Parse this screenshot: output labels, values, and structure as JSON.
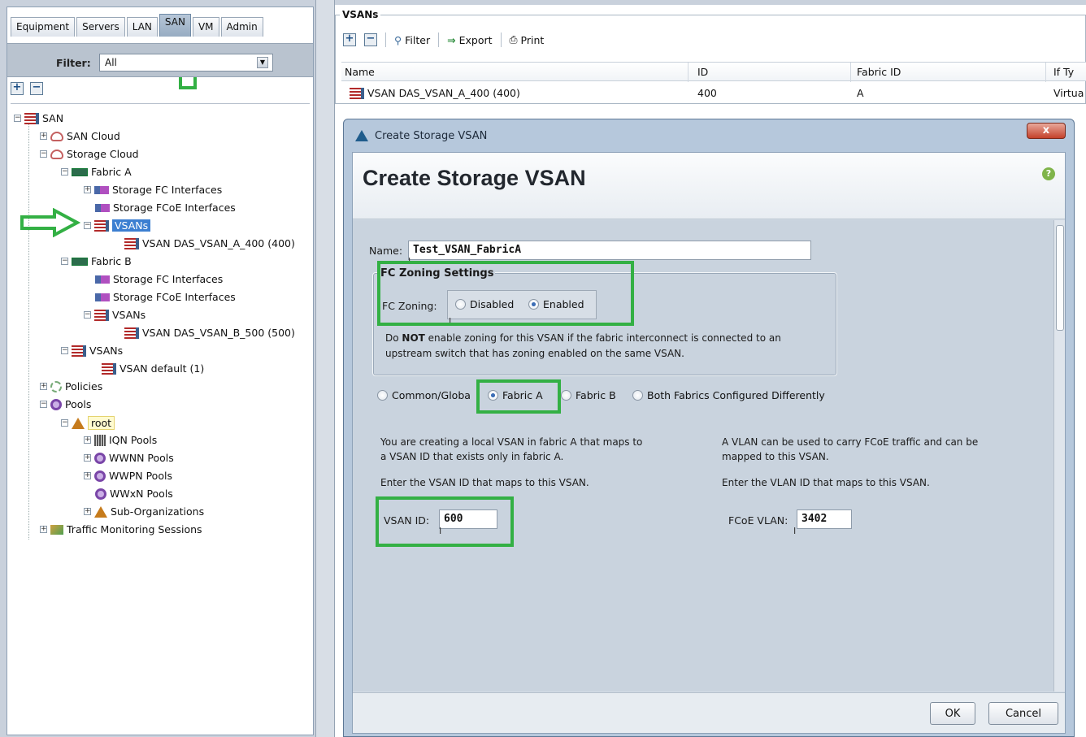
{
  "left": {
    "tabs": [
      "Equipment",
      "Servers",
      "LAN",
      "SAN",
      "VM",
      "Admin"
    ],
    "active_tab": "SAN",
    "filter_label": "Filter:",
    "filter_value": "All",
    "tree": [
      {
        "label": "SAN"
      },
      {
        "label": "SAN Cloud"
      },
      {
        "label": "Storage Cloud"
      },
      {
        "label": "Fabric A"
      },
      {
        "label": "Storage FC Interfaces"
      },
      {
        "label": "Storage FCoE Interfaces"
      },
      {
        "label": "VSANs"
      },
      {
        "label": "VSAN DAS_VSAN_A_400 (400)"
      },
      {
        "label": "Fabric B"
      },
      {
        "label": "Storage FC Interfaces"
      },
      {
        "label": "Storage FCoE Interfaces"
      },
      {
        "label": "VSANs"
      },
      {
        "label": "VSAN DAS_VSAN_B_500 (500)"
      },
      {
        "label": "VSANs"
      },
      {
        "label": "VSAN default (1)"
      },
      {
        "label": "Policies"
      },
      {
        "label": "Pools"
      },
      {
        "label": "root"
      },
      {
        "label": "IQN Pools"
      },
      {
        "label": "WWNN Pools"
      },
      {
        "label": "WWPN Pools"
      },
      {
        "label": "WWxN Pools"
      },
      {
        "label": "Sub-Organizations"
      },
      {
        "label": "Traffic Monitoring Sessions"
      }
    ]
  },
  "right": {
    "section_title": "VSANs",
    "toolbar": {
      "filter": "Filter",
      "export": "Export",
      "print": "Print"
    },
    "columns": [
      "Name",
      "ID",
      "Fabric ID",
      "If Ty"
    ],
    "rows": [
      {
        "name": "VSAN DAS_VSAN_A_400 (400)",
        "id": "400",
        "fabric": "A",
        "iftype": "Virtua"
      }
    ]
  },
  "dialog": {
    "window_title": "Create Storage VSAN",
    "heading": "Create Storage VSAN",
    "close": "x",
    "help": "?",
    "name_label": "Name:",
    "name_value": "Test_VSAN_FabricA",
    "fc_group_title": "FC Zoning Settings",
    "fc_zoning_label": "FC Zoning:",
    "fc_disabled": "Disabled",
    "fc_enabled": "Enabled",
    "warn_pre": "Do ",
    "warn_bold": "NOT",
    "warn_post": " enable zoning for this VSAN if the fabric interconnect is connected to an",
    "warn_line2": "upstream switch that has zoning enabled on the same VSAN.",
    "fabric_options": [
      "Common/Globa",
      "Fabric A",
      "Fabric B",
      "Both Fabrics Configured Differently"
    ],
    "selected_fabric": "Fabric A",
    "desc_left_1": "You are creating a local VSAN in fabric A that maps to",
    "desc_left_2": "a VSAN ID that exists only in fabric A.",
    "desc_left_3": "Enter the VSAN ID that maps to this VSAN.",
    "desc_right_1": "A VLAN can be used to carry FCoE traffic and can be",
    "desc_right_2": "mapped to this VSAN.",
    "desc_right_3": "Enter the VLAN ID that maps to this VSAN.",
    "vsan_id_label": "VSAN ID:",
    "vsan_id_value": "600",
    "fcoe_vlan_label": "FCoE VLAN:",
    "fcoe_vlan_value": "3402",
    "ok": "OK",
    "cancel": "Cancel"
  },
  "colors": {
    "highlight": "#33b044",
    "selection": "#3c7fd1"
  }
}
